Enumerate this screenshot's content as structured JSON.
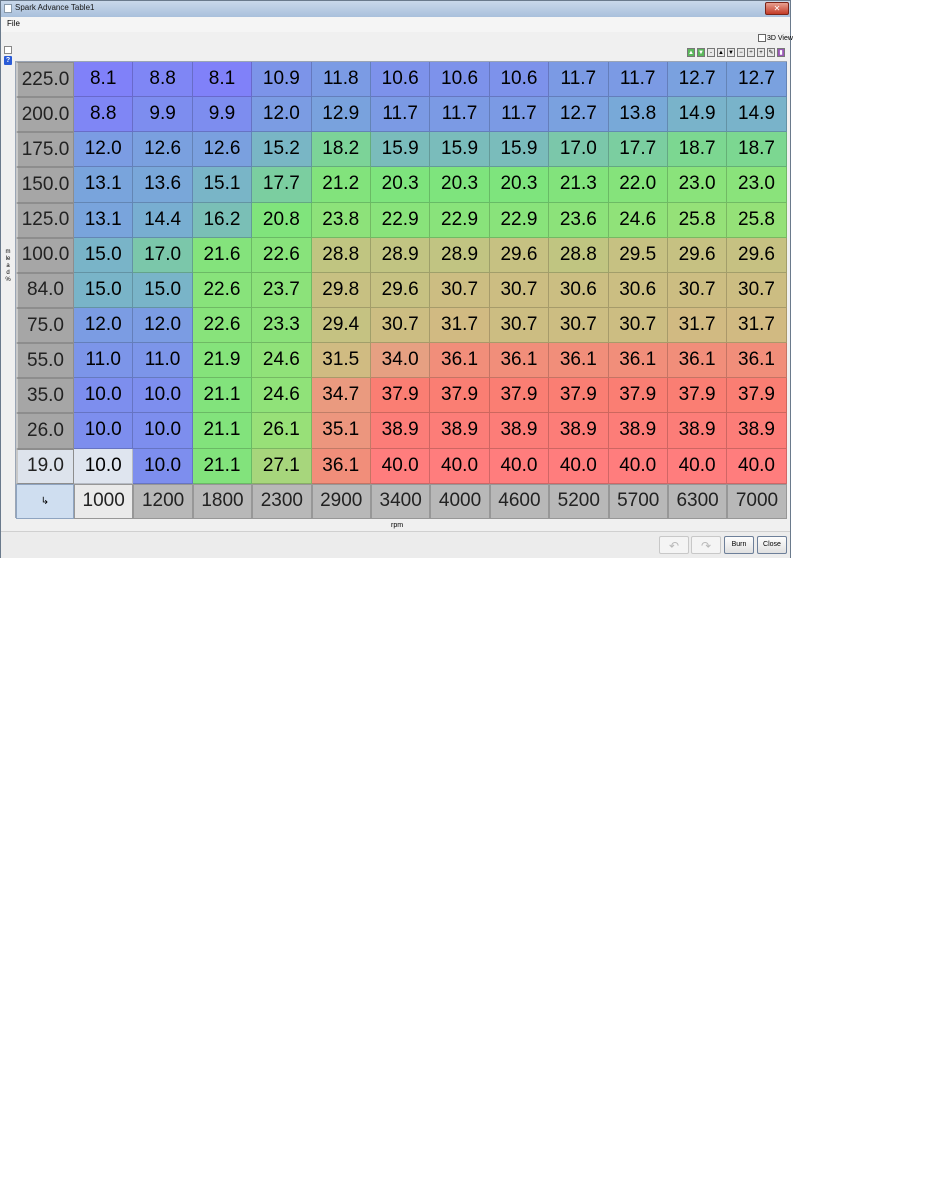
{
  "window": {
    "title": "Spark Advance Table1",
    "title_extra": "— ...",
    "close_glyph": "✕"
  },
  "menu": {
    "file": "File"
  },
  "view3d_label": "3D View",
  "toolbar": {
    "icons": [
      {
        "name": "up-green-icon",
        "glyph": "▲",
        "color": "#5cb85c"
      },
      {
        "name": "down-green-icon",
        "glyph": "▼",
        "color": "#5cb85c"
      },
      {
        "name": "minus-icon",
        "glyph": "-"
      },
      {
        "name": "up-icon",
        "glyph": "▲"
      },
      {
        "name": "down-icon",
        "glyph": "▼"
      },
      {
        "name": "minus-icon-2",
        "glyph": "−"
      },
      {
        "name": "interpolate-icon",
        "glyph": "÷"
      },
      {
        "name": "plus-icon",
        "glyph": "+"
      },
      {
        "name": "pencil-icon",
        "glyph": "✎"
      },
      {
        "name": "color-icon",
        "glyph": "▮",
        "color": "#9b59b6"
      }
    ]
  },
  "help_glyph": "?",
  "y_axis_label": "mlead %",
  "x_axis_label": "rpm",
  "corner_glyph": "↳",
  "table": {
    "row_labels": [
      "225.0",
      "200.0",
      "175.0",
      "150.0",
      "125.0",
      "100.0",
      "84.0",
      "75.0",
      "55.0",
      "35.0",
      "26.0",
      "19.0"
    ],
    "col_labels": [
      "1000",
      "1200",
      "1800",
      "2300",
      "2900",
      "3400",
      "4000",
      "4600",
      "5200",
      "5700",
      "6300",
      "7000"
    ],
    "rows": [
      [
        "8.1",
        "8.8",
        "8.1",
        "10.9",
        "11.8",
        "10.6",
        "10.6",
        "10.6",
        "11.7",
        "11.7",
        "12.7",
        "12.7"
      ],
      [
        "8.8",
        "9.9",
        "9.9",
        "12.0",
        "12.9",
        "11.7",
        "11.7",
        "11.7",
        "12.7",
        "13.8",
        "14.9",
        "14.9"
      ],
      [
        "12.0",
        "12.6",
        "12.6",
        "15.2",
        "18.2",
        "15.9",
        "15.9",
        "15.9",
        "17.0",
        "17.7",
        "18.7",
        "18.7"
      ],
      [
        "13.1",
        "13.6",
        "15.1",
        "17.7",
        "21.2",
        "20.3",
        "20.3",
        "20.3",
        "21.3",
        "22.0",
        "23.0",
        "23.0"
      ],
      [
        "13.1",
        "14.4",
        "16.2",
        "20.8",
        "23.8",
        "22.9",
        "22.9",
        "22.9",
        "23.6",
        "24.6",
        "25.8",
        "25.8"
      ],
      [
        "15.0",
        "17.0",
        "21.6",
        "22.6",
        "28.8",
        "28.9",
        "28.9",
        "29.6",
        "28.8",
        "29.5",
        "29.6",
        "29.6"
      ],
      [
        "15.0",
        "15.0",
        "22.6",
        "23.7",
        "29.8",
        "29.6",
        "30.7",
        "30.7",
        "30.6",
        "30.6",
        "30.7",
        "30.7"
      ],
      [
        "12.0",
        "12.0",
        "22.6",
        "23.3",
        "29.4",
        "30.7",
        "31.7",
        "30.7",
        "30.7",
        "30.7",
        "31.7",
        "31.7"
      ],
      [
        "11.0",
        "11.0",
        "21.9",
        "24.6",
        "31.5",
        "34.0",
        "36.1",
        "36.1",
        "36.1",
        "36.1",
        "36.1",
        "36.1"
      ],
      [
        "10.0",
        "10.0",
        "21.1",
        "24.6",
        "34.7",
        "37.9",
        "37.9",
        "37.9",
        "37.9",
        "37.9",
        "37.9",
        "37.9"
      ],
      [
        "10.0",
        "10.0",
        "21.1",
        "26.1",
        "35.1",
        "38.9",
        "38.9",
        "38.9",
        "38.9",
        "38.9",
        "38.9",
        "38.9"
      ],
      [
        "10.0",
        "10.0",
        "21.1",
        "27.1",
        "36.1",
        "40.0",
        "40.0",
        "40.0",
        "40.0",
        "40.0",
        "40.0",
        "40.0"
      ]
    ],
    "selected_row": "19.0",
    "selected_col": "1000"
  },
  "buttons": {
    "undo_glyph": "↶",
    "redo_glyph": "↷",
    "burn": "Burn",
    "close": "Close"
  }
}
